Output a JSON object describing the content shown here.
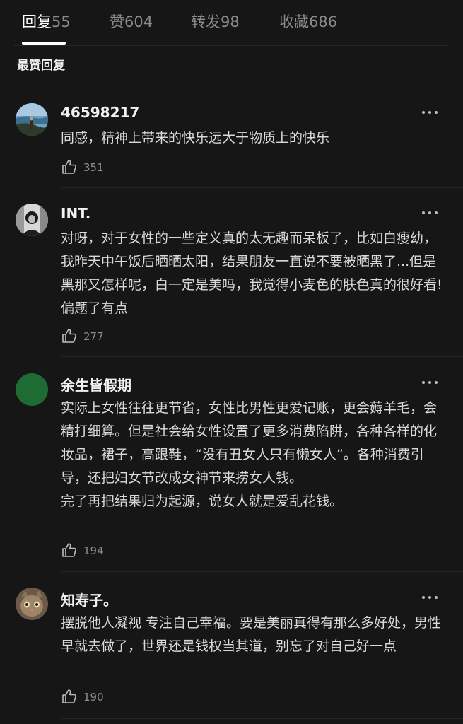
{
  "tabs": [
    {
      "label": "回复",
      "count": "55"
    },
    {
      "label": "赞",
      "count": "604"
    },
    {
      "label": "转发",
      "count": "98"
    },
    {
      "label": "收藏",
      "count": "686"
    }
  ],
  "section_title": "最赞回复",
  "comments": [
    {
      "username": "46598217",
      "avatar": "avatar-landscape-photo",
      "text": "同感，精神上带来的快乐远大于物质上的快乐",
      "likes": "351"
    },
    {
      "username": "INT.",
      "avatar": "avatar-monochrome-portrait",
      "text": "对呀，对于女性的一些定义真的太无趣而呆板了，比如白瘦幼，我昨天中午饭后晒晒太阳，结果朋友一直说不要被晒黑了...但是黑那又怎样呢，白一定是美吗，我觉得小麦色的肤色真的很好看!偏题了有点",
      "likes": "277"
    },
    {
      "username": "余生皆假期",
      "avatar": "avatar-green-circle",
      "text": "实际上女性往往更节省，女性比男性更爱记账，更会薅羊毛，会精打细算。但是社会给女性设置了更多消费陷阱，各种各样的化妆品，裙子，高跟鞋，“没有丑女人只有懒女人”。各种消费引导，还把妇女节改成女神节来捞女人钱。\n完了再把结果归为起源，说女人就是爱乱花钱。",
      "likes": "194"
    },
    {
      "username": "知寿子。",
      "avatar": "avatar-cat-photo",
      "text": "摆脱他人凝视 专注自己幸福。要是美丽真得有那么多好处，男性早就去做了，世界还是钱权当其道，别忘了对自己好一点",
      "likes": "190"
    }
  ],
  "colors": {
    "background": "#161616",
    "text_primary": "#f2f2f2",
    "text_secondary": "#8c8c8c",
    "green_avatar": "#1f6b34"
  },
  "icons": [
    "more-icon",
    "thumbs-up-icon"
  ]
}
